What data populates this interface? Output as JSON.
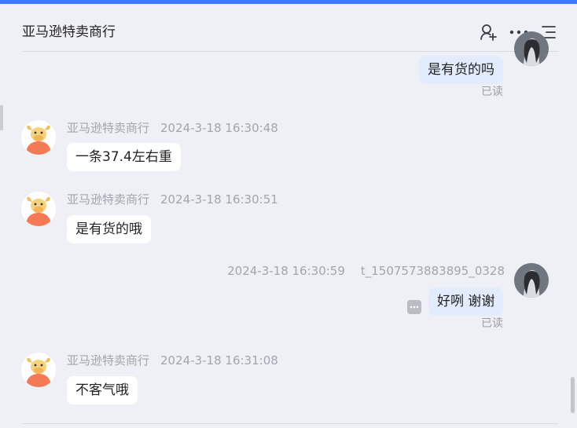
{
  "header": {
    "title": "亚马逊特卖商行",
    "icons": [
      "add-person-icon",
      "more-icon",
      "list-menu-icon"
    ]
  },
  "messages": [
    {
      "direction": "out",
      "text": "是有货的吗",
      "status": "已读"
    },
    {
      "direction": "in",
      "sender": "亚马逊特卖商行",
      "time": "2024-3-18 16:30:48",
      "text": "一条37.4左右重"
    },
    {
      "direction": "in",
      "sender": "亚马逊特卖商行",
      "time": "2024-3-18 16:30:51",
      "text": "是有货的哦"
    },
    {
      "direction": "out",
      "sender": "t_1507573883895_0328",
      "time": "2024-3-18 16:30:59",
      "text": "好咧 谢谢",
      "status": "已读"
    },
    {
      "direction": "in",
      "sender": "亚马逊特卖商行",
      "time": "2024-3-18 16:31:08",
      "text": "不客气哦"
    }
  ],
  "colors": {
    "accent": "#3f7cf4",
    "background": "#eff0f5",
    "outgoing_bubble": "#e3ecfd",
    "incoming_bubble": "#ffffff",
    "meta_text": "#a2a5ab"
  }
}
